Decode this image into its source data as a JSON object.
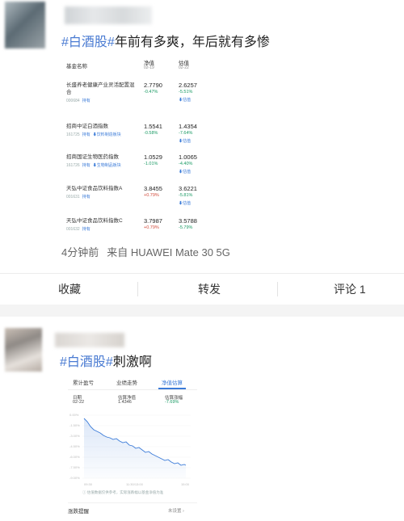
{
  "post1": {
    "hashtag": "#白酒股#",
    "text": "年前有多爽，年后就有多惨",
    "fund_table": {
      "header": {
        "name": "基金名称",
        "nav": "净值",
        "nav_date": "02-19",
        "est": "估值",
        "est_date": "02-22"
      },
      "rows": [
        {
          "name": "长盛养老健康产业灵活配置混合",
          "code": "000684",
          "hold": "持有",
          "board": "",
          "nav": "2.7790",
          "nav_pct": "-0.47%",
          "est": "2.6257",
          "est_pct": "-5.51%",
          "est_label": "估值"
        },
        {
          "name": "招商中证白酒指数",
          "code": "161725",
          "hold": "持有",
          "board": "饮料制造板块",
          "nav": "1.5541",
          "nav_pct": "-0.58%",
          "est": "1.4354",
          "est_pct": "-7.64%",
          "est_label": "估值"
        },
        {
          "name": "招商国证生物医药指数",
          "code": "161726",
          "hold": "持有",
          "board": "生物制品板块",
          "nav": "1.0529",
          "nav_pct": "-1.01%",
          "est": "1.0065",
          "est_pct": "-4.40%",
          "est_label": "估值"
        },
        {
          "name": "天弘中证食品饮料指数A",
          "code": "001631",
          "hold": "持有",
          "board": "",
          "nav": "3.8455",
          "nav_pct": "+0.79%",
          "est": "3.6221",
          "est_pct": "-5.81%",
          "est_label": "估值"
        },
        {
          "name": "天弘中证食品饮料指数C",
          "code": "001632",
          "hold": "持有",
          "board": "",
          "nav": "3.7987",
          "nav_pct": "+0.79%",
          "est": "3.5788",
          "est_pct": "-5.79%",
          "est_label": "估值"
        }
      ]
    },
    "time": "4分钟前",
    "source": "来自 HUAWEI Mate 30 5G"
  },
  "actions": {
    "collect": "收藏",
    "repost": "转发",
    "comment": "评论 1"
  },
  "post2": {
    "hashtag": "#白酒股#",
    "text": "刺激啊",
    "tabs": [
      "累计盈亏",
      "业绩走势",
      "净值估算"
    ],
    "active_tab": "净值估算",
    "stats": {
      "date_label": "日期",
      "date_value": "02-22",
      "est_label": "估算净值",
      "est_value": "1.4346",
      "chg_label": "估算涨幅",
      "chg_value": "-7.69%"
    },
    "chart_ylabels": [
      "0.00%",
      "-1.50%",
      "-3.00%",
      "-4.50%",
      "-6.00%",
      "-7.50%",
      "-9.00%"
    ],
    "chart_xlabels": [
      "09:30",
      "11:30/13:00",
      "15:00"
    ],
    "note": "估值数据仅供参考，实际涨跌幅以基金净值为准",
    "alert_label": "涨跌提醒",
    "alert_value": "未设置"
  }
}
